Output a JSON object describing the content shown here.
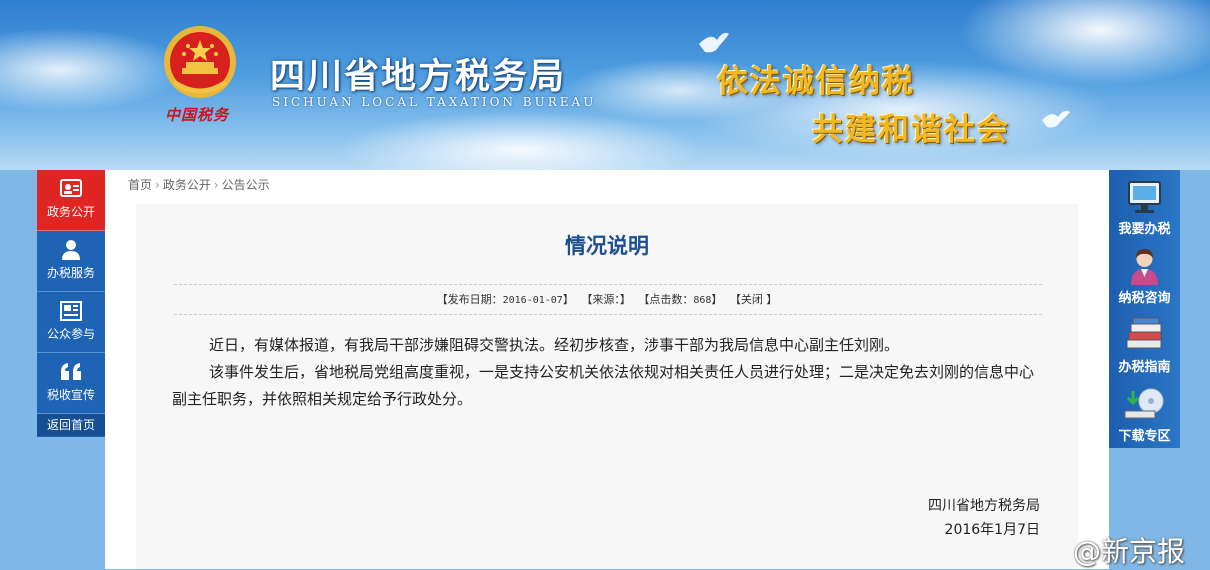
{
  "header": {
    "site_title": "四川省地方税务局",
    "site_subtitle": "SICHUAN LOCAL TAXATION BUREAU",
    "emblem_caption": "中国税务",
    "slogan_line1": "依法诚信纳税",
    "slogan_line2": "共建和谐社会"
  },
  "left_nav": {
    "items": [
      {
        "label": "政务公开",
        "icon": "id-card-icon",
        "active": true
      },
      {
        "label": "办税服务",
        "icon": "user-icon",
        "active": false
      },
      {
        "label": "公众参与",
        "icon": "newspaper-icon",
        "active": false
      },
      {
        "label": "税收宣传",
        "icon": "quote-icon",
        "active": false
      }
    ],
    "home": "返回首页"
  },
  "right_nav": {
    "items": [
      {
        "label": "我要办税",
        "icon": "monitor-icon"
      },
      {
        "label": "纳税咨询",
        "icon": "consultant-icon"
      },
      {
        "label": "办税指南",
        "icon": "books-icon"
      },
      {
        "label": "下载专区",
        "icon": "download-icon"
      }
    ]
  },
  "breadcrumb": [
    "首页",
    "政务公开",
    "公告公示"
  ],
  "article": {
    "title": "情况说明",
    "meta": {
      "publish_label": "【发布日期：",
      "publish_date": "2016-01-07",
      "publish_close": "】",
      "source_label": "【来源：",
      "source_close": "】",
      "clicks_label": "【点击数：",
      "clicks": "868",
      "clicks_close": "】",
      "close_label": "【关闭 】"
    },
    "paragraphs": [
      "近日，有媒体报道，有我局干部涉嫌阻碍交警执法。经初步核查，涉事干部为我局信息中心副主任刘刚。",
      "该事件发生后，省地税局党组高度重视，一是支持公安机关依法依规对相关责任人员进行处理；二是决定免去刘刚的信息中心副主任职务，并依照相关规定给予行政处分。"
    ],
    "signature_org": "四川省地方税务局",
    "signature_date": "2016年1月7日"
  },
  "watermark": "@新京报"
}
